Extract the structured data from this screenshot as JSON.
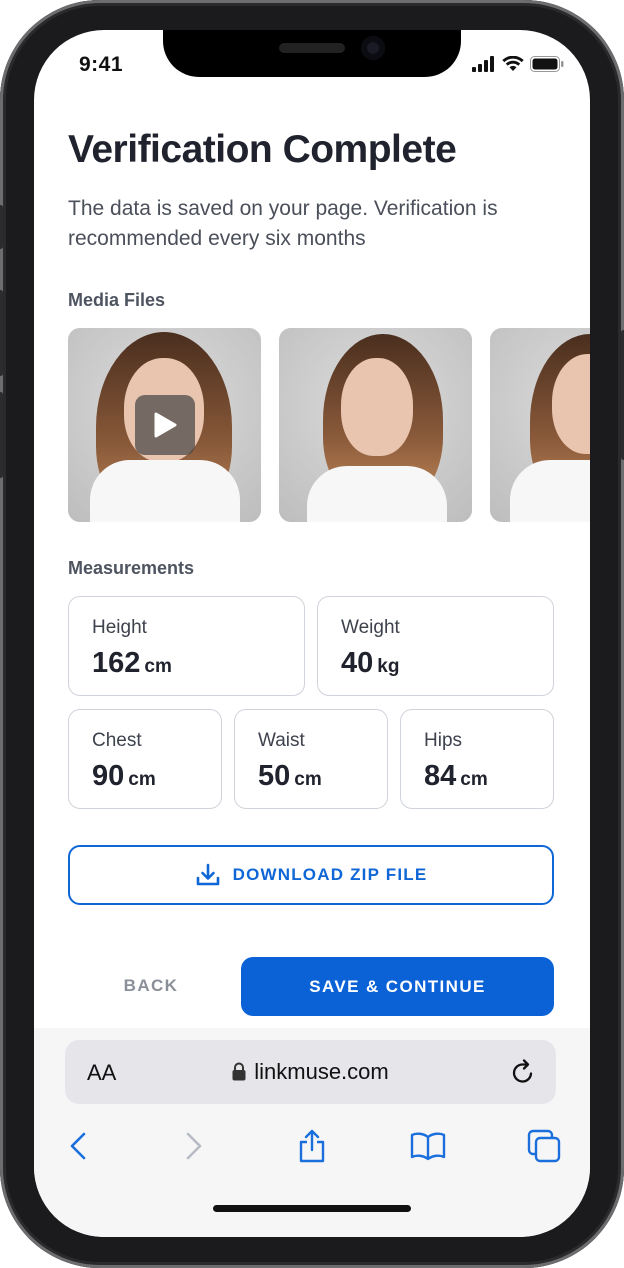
{
  "status_bar": {
    "time": "9:41"
  },
  "page": {
    "title": "Verification Complete",
    "subtitle": "The data is saved on your page. Verification is recommended every six months"
  },
  "media": {
    "label": "Media Files",
    "items": [
      {
        "type": "video",
        "icon": "play-icon"
      },
      {
        "type": "photo"
      },
      {
        "type": "photo"
      }
    ]
  },
  "measurements": {
    "label": "Measurements",
    "height": {
      "label": "Height",
      "value": "162",
      "unit": "cm"
    },
    "weight": {
      "label": "Weight",
      "value": "40",
      "unit": "kg"
    },
    "chest": {
      "label": "Chest",
      "value": "90",
      "unit": "cm"
    },
    "waist": {
      "label": "Waist",
      "value": "50",
      "unit": "cm"
    },
    "hips": {
      "label": "Hips",
      "value": "84",
      "unit": "cm"
    }
  },
  "actions": {
    "download_label": "DOWNLOAD ZIP FILE",
    "back_label": "BACK",
    "continue_label": "SAVE & CONTINUE"
  },
  "browser": {
    "text_size_label": "AA",
    "url": "linkmuse.com",
    "toolbar": [
      "back-icon",
      "forward-icon",
      "share-icon",
      "bookmarks-icon",
      "tabs-icon"
    ]
  },
  "colors": {
    "accent": "#0b62d6",
    "text_primary": "#20232d",
    "text_secondary": "#4a4f5a",
    "card_border": "#cfd3da",
    "disabled": "#b7bcc4"
  }
}
